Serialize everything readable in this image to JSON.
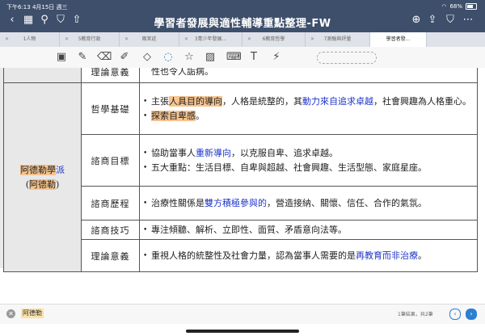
{
  "status": {
    "time_date": "下午6:13 4月15日 週三",
    "battery": "68%"
  },
  "window": {
    "title": "學習者發展與適性輔導重點整理-FW"
  },
  "tabs": [
    {
      "label": "1人物"
    },
    {
      "label": "5教育行政"
    },
    {
      "label": "兩宮廷"
    },
    {
      "label": "3青少年發展..."
    },
    {
      "label": "6教育哲學"
    },
    {
      "label": "7測驗與評量"
    },
    {
      "label": "學習者發..."
    }
  ],
  "toolbar_icons": [
    "scan-text-icon",
    "pen-icon",
    "eraser-icon",
    "highlighter-icon",
    "shapes-icon",
    "lasso-icon",
    "sticker-icon",
    "image-icon",
    "keyboard-icon",
    "text-box-icon",
    "laser-pointer-icon"
  ],
  "table": {
    "top_row_text": "性也令人詬病。",
    "top_row_topic": "理論意義",
    "school": {
      "name_line1_a": "阿德勒學",
      "name_line1_b": "派",
      "name_line2_open": "(",
      "name_line2": "阿德勒",
      "name_line2_close": ")"
    },
    "rows": [
      {
        "topic": "哲學基礎",
        "b1_pre": "主張",
        "b1_hl": "人具目的導向",
        "b1_mid": "，人格是統整的，其",
        "b1_blue": "動力來自追求卓越",
        "b1_post": "，社會興趣為人格重心。",
        "b2_hl": "探索自卑感",
        "b2_post": "。"
      },
      {
        "topic": "諮商目標",
        "b1_pre": "協助當事人",
        "b1_blue": "重新導向",
        "b1_post": "，以克服自卑、追求卓越。",
        "b2": "五大重點：生活目標、自卑與超越、社會興趣、生活型態、家庭星座。"
      },
      {
        "topic": "諮商歷程",
        "b1_pre": "治療性關係是",
        "b1_blue": "雙方積極參與的",
        "b1_post": "，營造接納、關懷、信任、合作的氣氛。"
      },
      {
        "topic": "諮商技巧",
        "b1": "專注傾聽、解析、立即性、面質、矛盾意向法等。"
      },
      {
        "topic": "理論意義",
        "b1_pre": "重視人格的統整性及社會力量，認為當事人需要的是",
        "b1_blue": "再教育而非治療",
        "b1_post": "。"
      }
    ]
  },
  "find": {
    "query": "阿德勒",
    "result_count": "1筆結果，共2筆"
  },
  "colors": {
    "titlebar": "#3e4f6b",
    "highlight": "#f6c48f",
    "blue_text": "#1f35c8",
    "accent": "#2d7fd1"
  }
}
